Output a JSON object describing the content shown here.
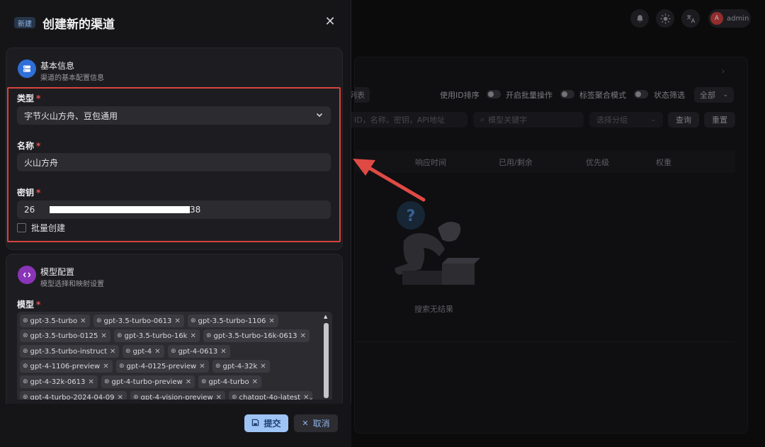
{
  "topbar": {
    "icons": [
      "bell-icon",
      "sun-icon",
      "translate-icon"
    ],
    "user": {
      "avatar_letter": "A",
      "name": "admin"
    }
  },
  "background": {
    "tab_chip": "列表",
    "toggles": [
      {
        "label": "使用ID排序"
      },
      {
        "label": "开启批量操作"
      },
      {
        "label": "标签聚合模式"
      }
    ],
    "status_filter_label": "状态筛选",
    "status_filter_value": "全部",
    "search_placeholder": "ID，名称，密钥，API地址",
    "model_search_placeholder": "模型关键字",
    "group_select_placeholder": "选择分组",
    "query_button": "查询",
    "reset_button": "重置",
    "table_headers": [
      "响应时间",
      "已用/剩余",
      "优先级",
      "权重"
    ],
    "empty_text": "搜索无结果"
  },
  "sheet": {
    "new_tag": "新建",
    "title": "创建新的渠道",
    "close_symbol": "✕",
    "basic_section": {
      "title": "基本信息",
      "subtitle": "渠道的基本配置信息",
      "type_label": "类型",
      "type_value": "字节火山方舟、豆包通用",
      "name_label": "名称",
      "name_value": "火山方舟",
      "key_label": "密钥",
      "key_prefix": "26",
      "key_suffix": "38",
      "batch_label": "批量创建"
    },
    "model_section": {
      "title": "模型配置",
      "subtitle": "模型选择和映射设置",
      "models_label": "模型",
      "models": [
        "gpt-3.5-turbo",
        "gpt-3.5-turbo-0613",
        "gpt-3.5-turbo-1106",
        "gpt-3.5-turbo-0125",
        "gpt-3.5-turbo-16k",
        "gpt-3.5-turbo-16k-0613",
        "gpt-3.5-turbo-instruct",
        "gpt-4",
        "gpt-4-0613",
        "gpt-4-1106-preview",
        "gpt-4-0125-preview",
        "gpt-4-32k",
        "gpt-4-32k-0613",
        "gpt-4-turbo-preview",
        "gpt-4-turbo",
        "gpt-4-turbo-2024-04-09",
        "gpt-4-vision-preview",
        "chatgpt-4o-latest"
      ]
    },
    "submit_button": "提交",
    "cancel_button": "取消"
  },
  "colors": {
    "accent": "#9ec3f5",
    "required": "#e2534f",
    "annotation_red": "#d6443e"
  }
}
